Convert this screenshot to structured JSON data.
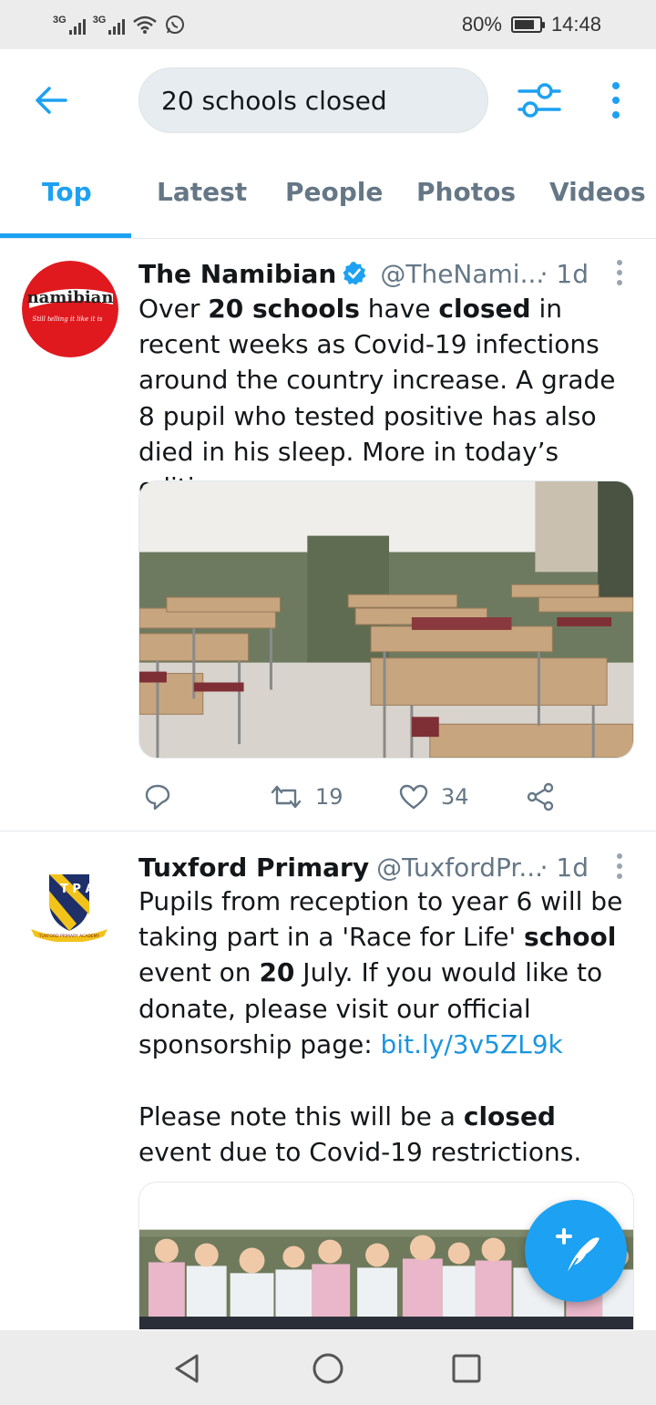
{
  "status": {
    "network1": "3G",
    "network2": "3G",
    "battery": "80%",
    "battery_level": 0.8,
    "time": "14:48"
  },
  "search": {
    "query": "20 schools closed"
  },
  "tabs": [
    {
      "label": "Top",
      "active": true
    },
    {
      "label": "Latest",
      "active": false
    },
    {
      "label": "People",
      "active": false
    },
    {
      "label": "Photos",
      "active": false
    },
    {
      "label": "Videos",
      "active": false
    }
  ],
  "tweets": [
    {
      "name": "The Namibian",
      "verified": true,
      "handle": "@TheNami...",
      "time": "· 1d",
      "avatar_text": "namibian",
      "avatar_tagline": "Still telling it like it is",
      "text_parts": [
        {
          "t": "Over ",
          "b": false
        },
        {
          "t": "20 schools",
          "b": true
        },
        {
          "t": " have ",
          "b": false
        },
        {
          "t": "closed",
          "b": true
        },
        {
          "t": " in recent weeks as Covid-19 infections around the country increase. A grade 8 pupil who tested positive has also died in his sleep. More in today’s edition.",
          "b": false
        }
      ],
      "image": "empty-classroom-photo",
      "replies": "",
      "retweets": "19",
      "likes": "34"
    },
    {
      "name": "Tuxford Primary",
      "verified": false,
      "handle": "@TuxfordPr...",
      "time": "· 1d",
      "avatar_text": "T P A",
      "avatar_tagline": "TUXFORD PRIMARY ACADEMY",
      "text_parts": [
        {
          "t": "Pupils from reception to year 6 will be taking part in a 'Race for Life' ",
          "b": false
        },
        {
          "t": "school",
          "b": true
        },
        {
          "t": " event on ",
          "b": false
        },
        {
          "t": "20",
          "b": true
        },
        {
          "t": " July. If you would like to donate, please visit our official sponsorship page: ",
          "b": false
        }
      ],
      "link": "bit.ly/3v5ZL9k",
      "text2_parts": [
        {
          "t": "Please note this will be a ",
          "b": false
        },
        {
          "t": "closed",
          "b": true
        },
        {
          "t": " event due to Covid-19 restrictions.",
          "b": false
        }
      ],
      "image": "children-running-photo"
    }
  ],
  "icons": {
    "back": "arrow-left-icon",
    "filter": "sliders-icon",
    "more": "more-vertical-icon",
    "fab": "compose-tweet-icon"
  },
  "colors": {
    "accent": "#1da1f2",
    "text": "#14171a",
    "secondary": "#657786",
    "namibian_red": "#e0191f"
  }
}
